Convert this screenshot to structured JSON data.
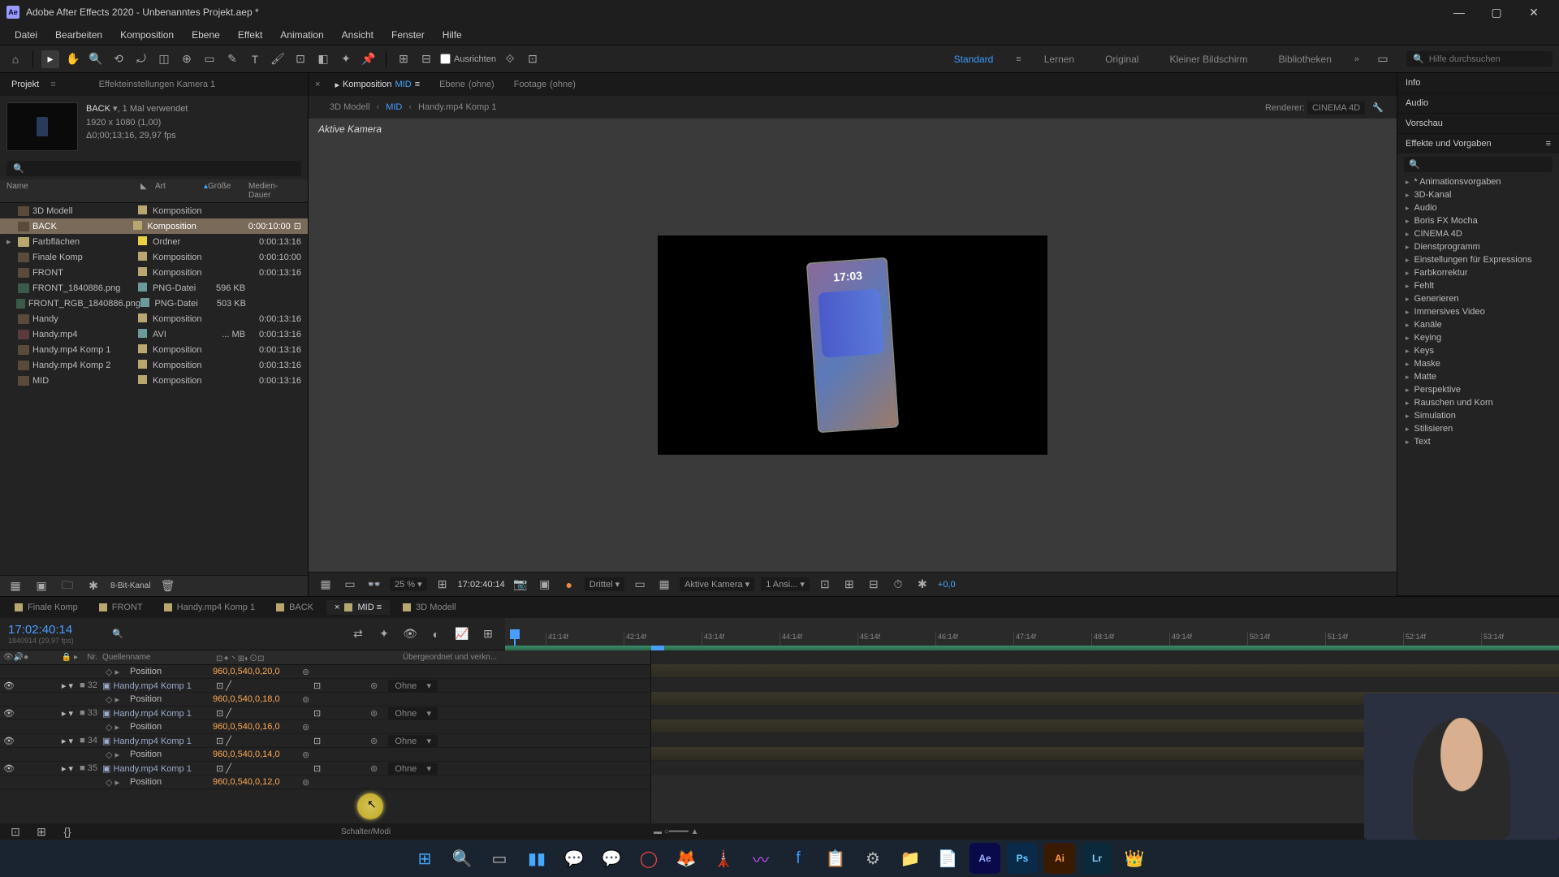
{
  "app": {
    "title": "Adobe After Effects 2020 - Unbenanntes Projekt.aep *"
  },
  "menu": [
    "Datei",
    "Bearbeiten",
    "Komposition",
    "Ebene",
    "Effekt",
    "Animation",
    "Ansicht",
    "Fenster",
    "Hilfe"
  ],
  "toolbar": {
    "align_label": "Ausrichten",
    "workspaces": [
      "Standard",
      "Lernen",
      "Original",
      "Kleiner Bildschirm",
      "Bibliotheken"
    ],
    "active_workspace": "Standard",
    "search_placeholder": "Hilfe durchsuchen"
  },
  "project_panel": {
    "tab": "Projekt",
    "settings_tab": "Effekteinstellungen Kamera 1",
    "selected": {
      "name": "BACK",
      "usage": ", 1 Mal verwendet",
      "dims": "1920 x 1080 (1,00)",
      "duration": "Δ0;00;13;16, 29,97 fps"
    },
    "columns": {
      "name": "Name",
      "label": "",
      "type": "Art",
      "size": "Größe",
      "duration": "Medien-Dauer"
    },
    "items": [
      {
        "name": "3D Modell",
        "type": "Komposition",
        "size": "",
        "dur": "",
        "icon": "comp",
        "label": "#b8a870"
      },
      {
        "name": "BACK",
        "type": "Komposition",
        "size": "",
        "dur": "0:00:10:00",
        "icon": "comp",
        "label": "#b8a870",
        "selected": true,
        "extra": true
      },
      {
        "name": "Farbflächen",
        "type": "Ordner",
        "size": "",
        "dur": "0:00:13:16",
        "icon": "fold",
        "label": "#e8d040"
      },
      {
        "name": "Finale Komp",
        "type": "Komposition",
        "size": "",
        "dur": "0:00:10:00",
        "icon": "comp",
        "label": "#b8a870"
      },
      {
        "name": "FRONT",
        "type": "Komposition",
        "size": "",
        "dur": "0:00:13:16",
        "icon": "comp",
        "label": "#b8a870"
      },
      {
        "name": "FRONT_1840886.png",
        "type": "PNG-Datei",
        "size": "596 KB",
        "dur": "",
        "icon": "img",
        "label": "#6a9a9a"
      },
      {
        "name": "FRONT_RGB_1840886.png",
        "type": "PNG-Datei",
        "size": "503 KB",
        "dur": "",
        "icon": "img",
        "label": "#6a9a9a"
      },
      {
        "name": "Handy",
        "type": "Komposition",
        "size": "",
        "dur": "0:00:13:16",
        "icon": "comp",
        "label": "#b8a870"
      },
      {
        "name": "Handy.mp4",
        "type": "AVI",
        "size": "... MB",
        "dur": "0:00:13:16",
        "icon": "vid",
        "label": "#6a9a9a"
      },
      {
        "name": "Handy.mp4 Komp 1",
        "type": "Komposition",
        "size": "",
        "dur": "0:00:13:16",
        "icon": "comp",
        "label": "#b8a870"
      },
      {
        "name": "Handy.mp4 Komp 2",
        "type": "Komposition",
        "size": "",
        "dur": "0:00:13:16",
        "icon": "comp",
        "label": "#b8a870"
      },
      {
        "name": "MID",
        "type": "Komposition",
        "size": "",
        "dur": "0:00:13:16",
        "icon": "comp",
        "label": "#b8a870"
      }
    ],
    "footer_depth": "8-Bit-Kanal"
  },
  "composition": {
    "tabs": [
      {
        "label": "Komposition",
        "name": "MID",
        "active": true
      },
      {
        "label": "Ebene",
        "name": "(ohne)"
      },
      {
        "label": "Footage",
        "name": "(ohne)"
      }
    ],
    "breadcrumb": [
      "3D Modell",
      "MID",
      "Handy.mp4 Komp 1"
    ],
    "active_crumb": "MID",
    "renderer_label": "Renderer:",
    "renderer": "CINEMA 4D",
    "viewport_label": "Aktive Kamera",
    "phone_time": "17:03",
    "viewer": {
      "zoom": "25 %",
      "timecode": "17:02:40:14",
      "res": "Drittel",
      "camera": "Aktive Kamera",
      "views": "1 Ansi...",
      "exposure": "+0,0"
    }
  },
  "right_panels": {
    "info": "Info",
    "audio": "Audio",
    "preview": "Vorschau",
    "effects_title": "Effekte und Vorgaben",
    "effects": [
      "* Animationsvorgaben",
      "3D-Kanal",
      "Audio",
      "Boris FX Mocha",
      "CINEMA 4D",
      "Dienstprogramm",
      "Einstellungen für Expressions",
      "Farbkorrektur",
      "Fehlt",
      "Generieren",
      "Immersives Video",
      "Kanäle",
      "Keying",
      "Keys",
      "Maske",
      "Matte",
      "Perspektive",
      "Rauschen und Korn",
      "Simulation",
      "Stilisieren",
      "Text"
    ]
  },
  "timeline": {
    "tabs": [
      {
        "label": "Finale Komp",
        "color": "#b8a870"
      },
      {
        "label": "FRONT",
        "color": "#b8a870"
      },
      {
        "label": "Handy.mp4 Komp 1",
        "color": "#b8a870"
      },
      {
        "label": "BACK",
        "color": "#b8a870"
      },
      {
        "label": "MID",
        "color": "#b8a870",
        "active": true
      },
      {
        "label": "3D Modell",
        "color": "#b8a870"
      }
    ],
    "timecode": "17:02:40:14",
    "subinfo": "1840914 (29,97 fps)",
    "columns": {
      "num": "Nr.",
      "source": "Quellenname",
      "parent": "Übergeordnet und verkn..."
    },
    "ruler": [
      "41:14f",
      "42:14f",
      "43:14f",
      "44:14f",
      "45:14f",
      "46:14f",
      "47:14f",
      "48:14f",
      "49:14f",
      "50:14f",
      "51:14f",
      "52:14f",
      "53:14f"
    ],
    "layers": [
      {
        "prop": true,
        "name": "Position",
        "value": "960,0,540,0,20,0"
      },
      {
        "num": "32",
        "name": "Handy.mp4 Komp 1",
        "parent": "Ohne"
      },
      {
        "prop": true,
        "name": "Position",
        "value": "960,0,540,0,18,0"
      },
      {
        "num": "33",
        "name": "Handy.mp4 Komp 1",
        "parent": "Ohne"
      },
      {
        "prop": true,
        "name": "Position",
        "value": "960,0,540,0,16,0"
      },
      {
        "num": "34",
        "name": "Handy.mp4 Komp 1",
        "parent": "Ohne"
      },
      {
        "prop": true,
        "name": "Position",
        "value": "960,0,540,0,14,0"
      },
      {
        "num": "35",
        "name": "Handy.mp4 Komp 1",
        "parent": "Ohne"
      },
      {
        "prop": true,
        "name": "Position",
        "value": "960,0,540,0,12,0"
      }
    ],
    "footer": "Schalter/Modi"
  }
}
